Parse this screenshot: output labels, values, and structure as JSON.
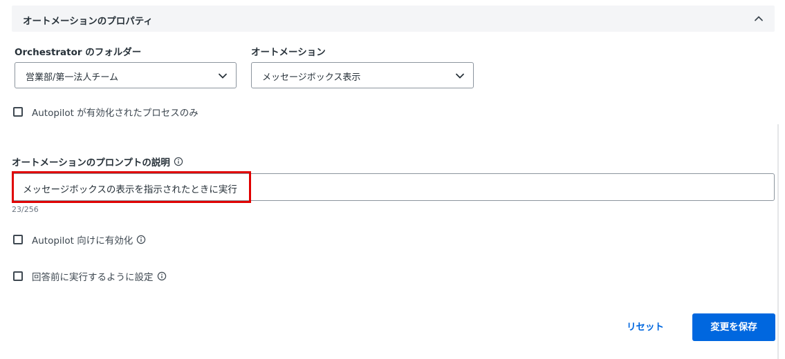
{
  "section": {
    "title": "オートメーションのプロパティ",
    "collapse_icon": "chevron-up-icon"
  },
  "folder": {
    "label": "Orchestrator のフォルダー",
    "value": "営業部/第一法人チーム"
  },
  "automation": {
    "label": "オートメーション",
    "value": "メッセージボックス表示"
  },
  "autopilot_only": {
    "label": "Autopilot が有効化されたプロセスのみ",
    "checked": false
  },
  "prompt_description": {
    "label": "オートメーションのプロンプトの説明",
    "value": "メッセージボックスの表示を指示されたときに実行",
    "counter": "23/256"
  },
  "enable_for_autopilot": {
    "label": "Autopilot 向けに有効化",
    "checked": false
  },
  "run_before_answer": {
    "label": "回答前に実行するように設定",
    "checked": false
  },
  "actions": {
    "reset_label": "リセット",
    "save_label": "変更を保存"
  },
  "colors": {
    "primary": "#0067df",
    "highlight": "#e00000",
    "header_bg": "#f4f5f7"
  }
}
